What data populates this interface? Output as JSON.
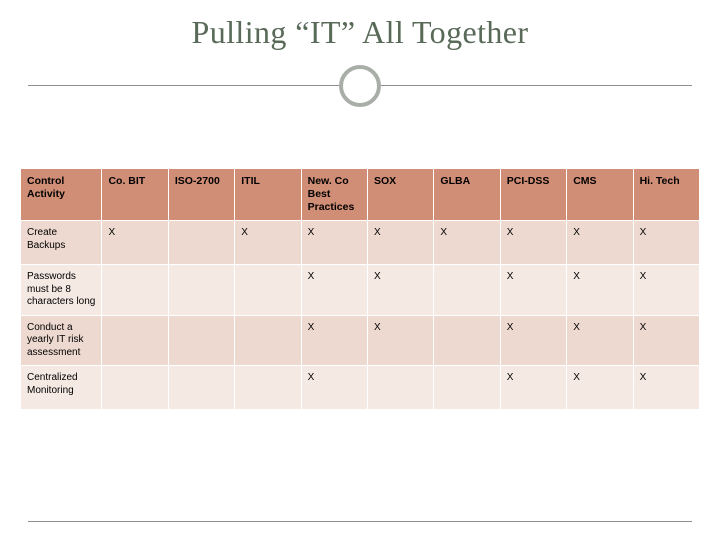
{
  "title": "Pulling “IT” All Together",
  "chart_data": {
    "type": "table",
    "columns": [
      "Control Activity",
      "Co. BIT",
      "ISO-2700",
      "ITIL",
      "New. Co Best Practices",
      "SOX",
      "GLBA",
      "PCI-DSS",
      "CMS",
      "Hi. Tech"
    ],
    "rows": [
      {
        "label": "Create Backups",
        "marks": [
          "X",
          "",
          "X",
          "X",
          "X",
          "X",
          "X",
          "X",
          "X"
        ]
      },
      {
        "label": "Passwords must be 8 characters long",
        "marks": [
          "",
          "",
          "",
          "X",
          "X",
          "",
          "X",
          "X",
          "X"
        ]
      },
      {
        "label": "Conduct a yearly IT risk assessment",
        "marks": [
          "",
          "",
          "",
          "X",
          "X",
          "",
          "X",
          "X",
          "X"
        ]
      },
      {
        "label": "Centralized Monitoring",
        "marks": [
          "",
          "",
          "",
          "X",
          "",
          "",
          "X",
          "X",
          "X"
        ]
      }
    ]
  }
}
